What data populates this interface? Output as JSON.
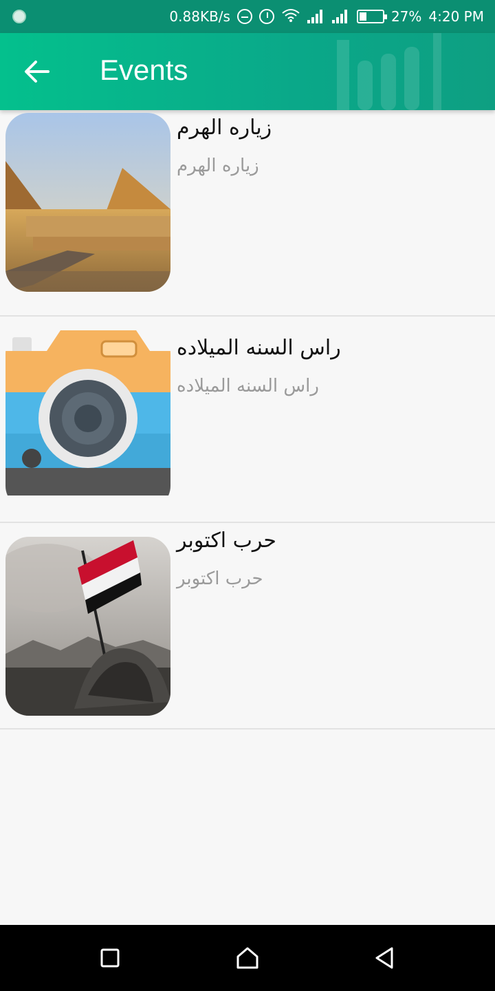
{
  "status_bar": {
    "network_speed": "0.88KB/s",
    "battery_percent": "27%",
    "time": "4:20 PM",
    "icons": [
      "app-notification-icon",
      "do-not-disturb-icon",
      "alarm-icon",
      "wifi-icon",
      "signal-icon",
      "signal-icon",
      "battery-charging-icon"
    ]
  },
  "app_bar": {
    "title": "Events",
    "back_icon": "arrow-left-icon",
    "color": "#04c08d"
  },
  "events": [
    {
      "title": "زياره الهرم",
      "subtitle": "زياره الهرم",
      "image": "pyramids-photo"
    },
    {
      "title": "راس السنه الميلاده",
      "subtitle": "راس السنه الميلاده",
      "image": "camera-icon-image"
    },
    {
      "title": "حرب اكتوبر",
      "subtitle": "حرب اكتوبر",
      "image": "october-war-flag-photo"
    }
  ],
  "nav_bar": {
    "icons": [
      "recent-apps-icon",
      "home-icon",
      "back-icon"
    ]
  }
}
